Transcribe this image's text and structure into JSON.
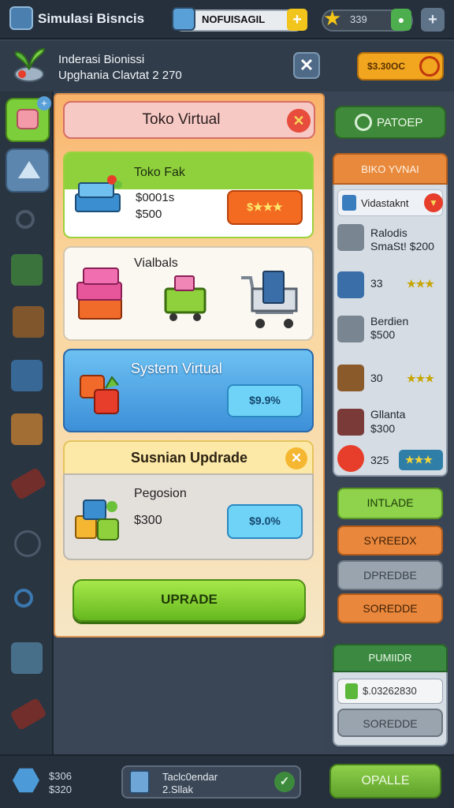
{
  "topbar": {
    "app_title": "Simulasi Bisncis",
    "notification_text": "NOFUISAGIL",
    "notification_plus": "+",
    "score": "339",
    "star_icon": "star-icon",
    "chat_icon": "chat-icon",
    "add_label": "+"
  },
  "header": {
    "line1": "Inderasi Bionissi",
    "line2": "Upghania Clavtat 2 270",
    "close_label": "✕",
    "search_label": "$3.30OC"
  },
  "main": {
    "title": "Toko Virtual",
    "close_label": "✕",
    "card1": {
      "title": "Toko Fak",
      "line1": "$0001s",
      "line2": "$500",
      "button": "$★★★"
    },
    "card2": {
      "title": "Vialbals"
    },
    "card3": {
      "title": "System Virtual",
      "button": "$9.9%"
    },
    "card4": {
      "title": "Susnian Updrade",
      "close_label": "✕",
      "line1": "Pegosion",
      "line2": "$300",
      "button": "$9.0%"
    },
    "upgrade_label": "UPRADE"
  },
  "right_panel": {
    "top_button": "PATOEP",
    "header": "BIKO YVNAI",
    "sub_label": "Vidastaknt",
    "rows": [
      {
        "text1": "Ralodis",
        "text2": "SmaSt! $200"
      },
      {
        "text1": "33",
        "stars": "★★★"
      },
      {
        "text1": "Berdien",
        "text2": "$500"
      },
      {
        "text1": "30",
        "stars": "★★★"
      },
      {
        "text1": "Gllanta",
        "text2": "$300"
      },
      {
        "text1": "325",
        "stars": "★★★"
      }
    ],
    "buttons": [
      "INTLADE",
      "SYREEDX",
      "DPREDBE",
      "SOREDDE"
    ],
    "panel2_header": "PUMIIDR",
    "panel2_field": "$.03262830",
    "panel2_button": "SOREDDE"
  },
  "bottombar": {
    "line1": "$306",
    "line2": "$320",
    "pill_line1": "Taclc0endar",
    "pill_line2": "2.Sllak",
    "check": "✓",
    "button": "OPALLE"
  },
  "colors": {
    "accent_green": "#8fd13c",
    "accent_orange": "#f36b21",
    "accent_blue": "#6fd3f7",
    "background": "#3a4656"
  }
}
